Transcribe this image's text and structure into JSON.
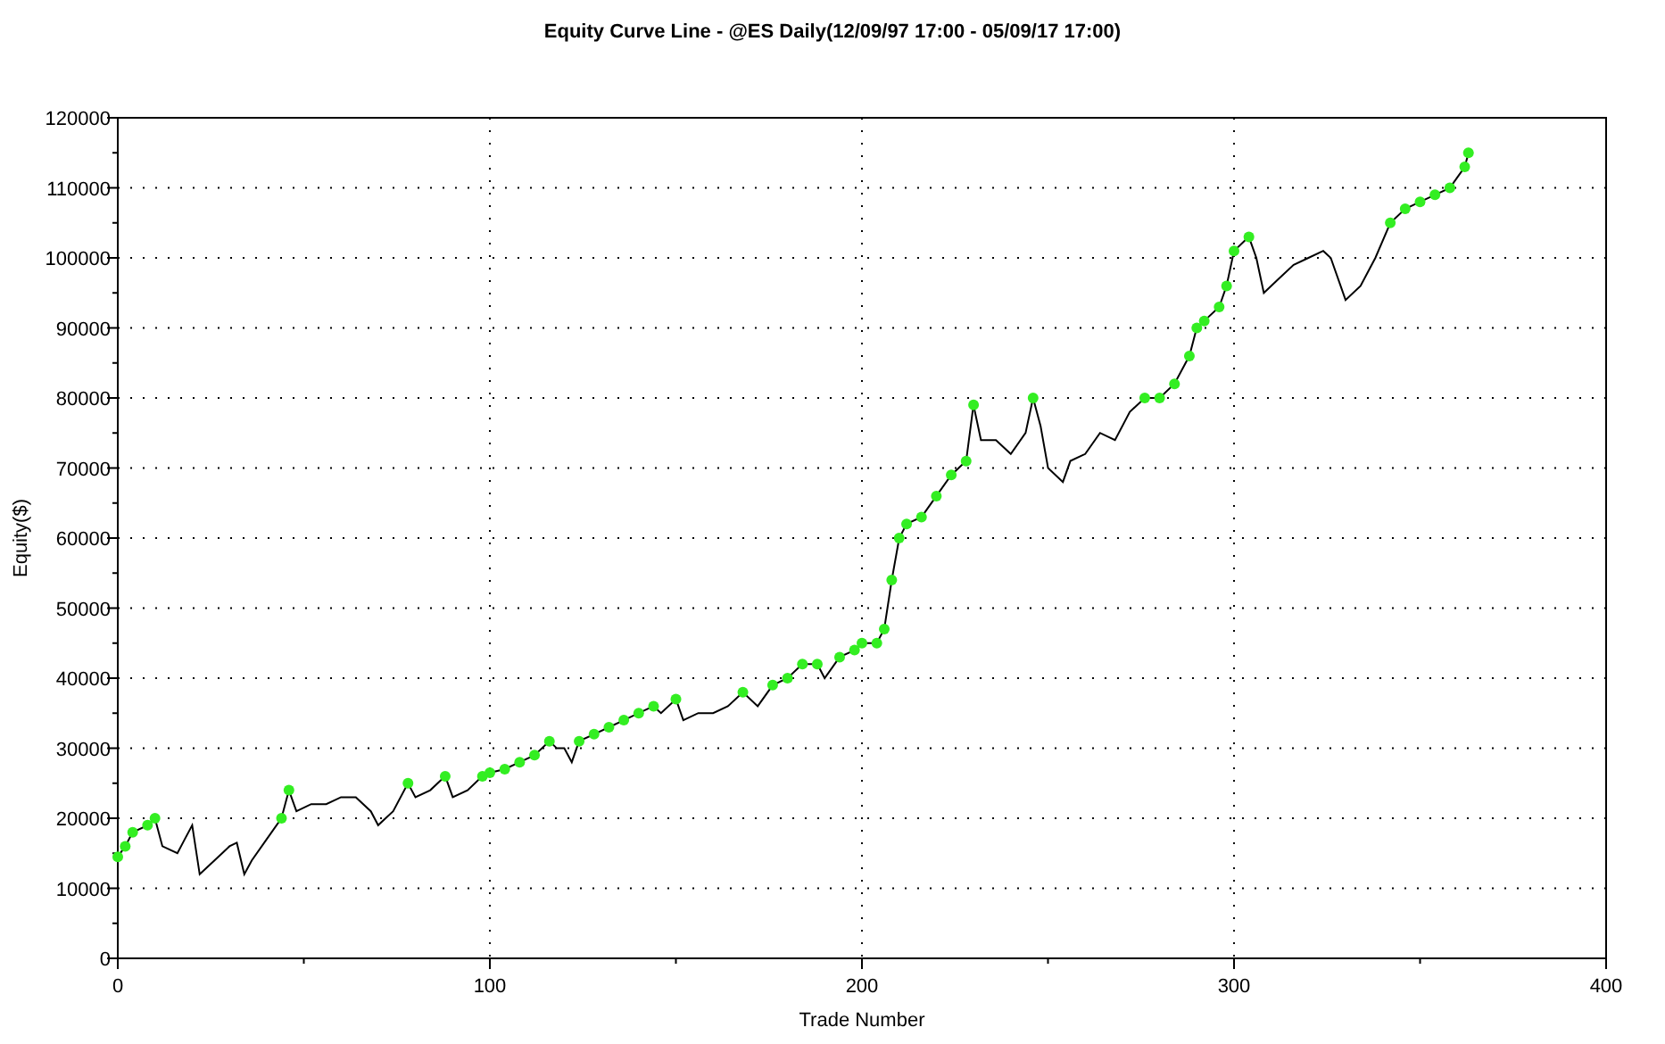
{
  "title": "Equity Curve Line - @ES Daily(12/09/97 17:00 - 05/09/17 17:00)",
  "chart_data": {
    "type": "line",
    "xlabel": "Trade Number",
    "ylabel": "Equity($)",
    "x": [
      0,
      2,
      4,
      8,
      10,
      12,
      16,
      18,
      20,
      22,
      26,
      30,
      32,
      34,
      36,
      40,
      44,
      46,
      48,
      52,
      56,
      60,
      64,
      68,
      70,
      74,
      78,
      80,
      84,
      88,
      90,
      94,
      98,
      100,
      104,
      108,
      112,
      116,
      118,
      120,
      122,
      124,
      128,
      132,
      136,
      140,
      144,
      146,
      150,
      152,
      156,
      160,
      164,
      168,
      172,
      176,
      180,
      184,
      188,
      190,
      194,
      198,
      200,
      204,
      206,
      208,
      210,
      212,
      216,
      220,
      224,
      228,
      230,
      232,
      236,
      240,
      244,
      246,
      248,
      250,
      254,
      256,
      260,
      264,
      268,
      272,
      276,
      280,
      284,
      288,
      290,
      292,
      296,
      298,
      300,
      304,
      306,
      308,
      312,
      316,
      320,
      324,
      326,
      330,
      334,
      338,
      342,
      346,
      350,
      354,
      358,
      362,
      363
    ],
    "grid": true,
    "series": [
      {
        "color": "#000000",
        "values": [
          14500,
          16000,
          18000,
          19000,
          20000,
          16000,
          15000,
          17000,
          19000,
          12000,
          14000,
          16000,
          16500,
          12000,
          14000,
          17000,
          20000,
          24000,
          21000,
          22000,
          22000,
          23000,
          23000,
          21000,
          19000,
          21000,
          25000,
          23000,
          24000,
          26000,
          23000,
          24000,
          26000,
          26500,
          27000,
          28000,
          29000,
          31000,
          30000,
          30000,
          28000,
          31000,
          32000,
          33000,
          34000,
          35000,
          36000,
          35000,
          37000,
          34000,
          35000,
          35000,
          36000,
          38000,
          36000,
          39000,
          40000,
          42000,
          42000,
          40000,
          43000,
          44000,
          45000,
          45000,
          47000,
          54000,
          60000,
          62000,
          63000,
          66000,
          69000,
          71000,
          79000,
          74000,
          74000,
          72000,
          75000,
          80000,
          76000,
          70000,
          68000,
          71000,
          72000,
          75000,
          74000,
          78000,
          80000,
          80000,
          82000,
          86000,
          90000,
          91000,
          93000,
          96000,
          101000,
          103000,
          100000,
          95000,
          97000,
          99000,
          100000,
          101000,
          100000,
          94000,
          96000,
          100000,
          105000,
          107000,
          108000,
          109000,
          110000,
          113000,
          115000
        ]
      }
    ],
    "xlim": [
      0,
      400
    ],
    "ylim": [
      0,
      120000
    ],
    "xticks": [
      0,
      100,
      200,
      300,
      400
    ],
    "yticks": [
      0,
      10000,
      20000,
      30000,
      40000,
      50000,
      60000,
      70000,
      80000,
      90000,
      100000,
      110000,
      120000
    ]
  }
}
